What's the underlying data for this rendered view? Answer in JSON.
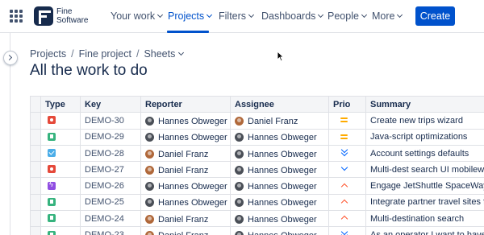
{
  "brand": {
    "line1": "Fine",
    "line2": "Software"
  },
  "nav": {
    "items": [
      {
        "label": "Your work",
        "active": false
      },
      {
        "label": "Projects",
        "active": true
      },
      {
        "label": "Filters",
        "active": false
      },
      {
        "label": "Dashboards",
        "active": false
      },
      {
        "label": "People",
        "active": false
      },
      {
        "label": "More",
        "active": false
      }
    ],
    "create_label": "Create"
  },
  "breadcrumb": {
    "items": [
      "Projects",
      "Fine project",
      "Sheets"
    ]
  },
  "page_title": "All the work to do",
  "colors": {
    "accent": "#0052cc",
    "bug": "#e5493a",
    "story": "#36b37e",
    "task": "#4bade8",
    "epic": "#904ee2"
  },
  "table": {
    "columns": [
      "Type",
      "Key",
      "Reporter",
      "Assignee",
      "Prio",
      "Summary"
    ],
    "rows": [
      {
        "type": "bug-icon",
        "key": "DEMO-30",
        "reporter": "Hannes Obweger",
        "assignee": "Daniel Franz",
        "prio": "medium-priority-icon",
        "summary": "Create new trips wizard"
      },
      {
        "type": "story-icon",
        "key": "DEMO-29",
        "reporter": "Hannes Obweger",
        "assignee": "Hannes Obweger",
        "prio": "medium-priority-icon",
        "summary": "Java-script optimizations"
      },
      {
        "type": "task-icon",
        "key": "DEMO-28",
        "reporter": "Daniel Franz",
        "assignee": "Hannes Obweger",
        "prio": "lowest-priority-icon",
        "summary": "Account settings defaults"
      },
      {
        "type": "bug-icon",
        "key": "DEMO-27",
        "reporter": "Daniel Franz",
        "assignee": "Hannes Obweger",
        "prio": "low-priority-icon",
        "summary": "Multi-dest search UI mobilewebs"
      },
      {
        "type": "epic-icon",
        "key": "DEMO-26",
        "reporter": "Hannes Obweger",
        "assignee": "Hannes Obweger",
        "prio": "high-priority-icon",
        "summary": "Engage JetShuttle SpaceWays fo"
      },
      {
        "type": "story-icon",
        "key": "DEMO-25",
        "reporter": "Hannes Obweger",
        "assignee": "Hannes Obweger",
        "prio": "high-priority-icon",
        "summary": "Integrate partner travel sites foo"
      },
      {
        "type": "story-icon",
        "key": "DEMO-24",
        "reporter": "Daniel Franz",
        "assignee": "Hannes Obweger",
        "prio": "high-priority-icon",
        "summary": "Multi-destination search"
      },
      {
        "type": "story-icon",
        "key": "DEMO-23",
        "reporter": "Daniel Franz",
        "assignee": "Hannes Obweger",
        "prio": "lowest-priority-icon",
        "summary": "As an operator I want to have a t"
      }
    ]
  }
}
